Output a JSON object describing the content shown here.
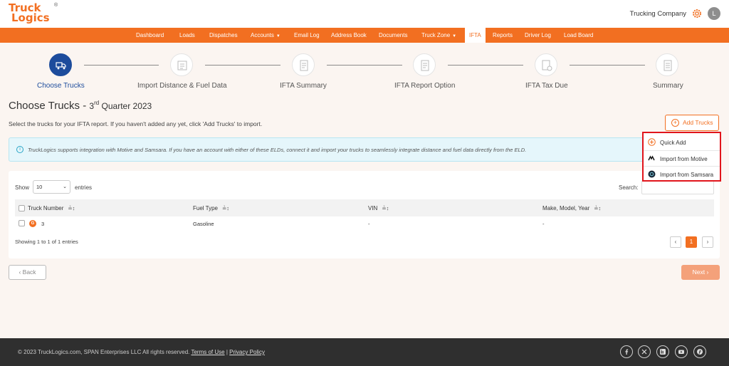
{
  "brand": {
    "logo_line1": "Truck",
    "logo_line2": "Logics",
    "registered": "®"
  },
  "header": {
    "company": "Trucking Company",
    "avatar_initial": "L"
  },
  "nav": {
    "dashboard": "Dashboard",
    "loads": "Loads",
    "dispatches": "Dispatches",
    "accounts": "Accounts",
    "email_log": "Email Log",
    "address_book": "Address Book",
    "documents": "Documents",
    "truck_zone": "Truck Zone",
    "ifta": "IFTA",
    "reports": "Reports",
    "driver_log": "Driver Log",
    "load_board": "Load Board"
  },
  "steps": [
    {
      "label": "Choose Trucks"
    },
    {
      "label": "Import Distance & Fuel Data"
    },
    {
      "label": "IFTA Summary"
    },
    {
      "label": "IFTA Report Option"
    },
    {
      "label": "IFTA Tax Due"
    },
    {
      "label": "Summary"
    }
  ],
  "page": {
    "title": "Choose Trucks - ",
    "quarter_num": "3",
    "quarter_sup": "rd",
    "quarter_rest": " Quarter 2023",
    "intro": "Select the trucks for your IFTA report. If you haven't added any yet, click 'Add Trucks' to import.",
    "add_trucks": "Add Trucks"
  },
  "info": {
    "message": "TruckLogics supports integration with Motive and Samsara. If you have an account with either of these ELDs, connect it and import your trucks to seamlessly integrate distance and fuel data directly from the ELD."
  },
  "dropdown": {
    "quick_add": "Quick Add",
    "import_motive": "Import from Motive",
    "import_samsara": "Import from Samsara"
  },
  "table": {
    "show_label": "Show",
    "page_size": "10",
    "entries_label": "entries",
    "search_label": "Search:",
    "columns": [
      "Truck Number",
      "Fuel Type",
      "VIN",
      "Make, Model, Year"
    ],
    "rows": [
      {
        "truck_number": "3",
        "fuel_type": "Gasoline",
        "vin": "-",
        "make_model_year": "-"
      }
    ],
    "showing": "Showing 1 to 1 of 1 entries",
    "prev": "‹",
    "current_page": "1",
    "next": "›"
  },
  "actions": {
    "back": "‹ Back",
    "next": "Next ›"
  },
  "footer": {
    "copyright": "© 2023 TruckLogics.com, SPAN Enterprises LLC All rights reserved.",
    "terms": "Terms of Use",
    "divider": "|",
    "privacy": "Privacy Policy"
  },
  "colors": {
    "brand_orange": "#f26f21",
    "step_blue": "#1d4c9c",
    "highlight_red": "#e1151c",
    "footer_bg": "#2f2f2f"
  }
}
